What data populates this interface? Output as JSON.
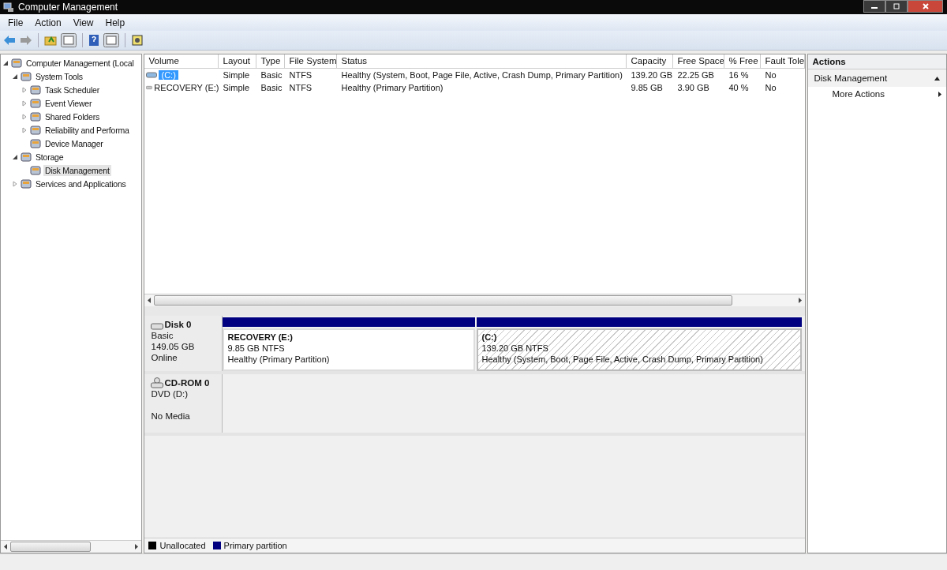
{
  "window": {
    "title": "Computer Management"
  },
  "menu": [
    "File",
    "Action",
    "View",
    "Help"
  ],
  "tree": [
    {
      "label": "Computer Management (Local",
      "expanded": true,
      "selected": false,
      "children": [
        {
          "label": "System Tools",
          "expanded": true,
          "selected": false,
          "children": [
            {
              "label": "Task Scheduler",
              "expanded": false,
              "selected": false
            },
            {
              "label": "Event Viewer",
              "expanded": false,
              "selected": false
            },
            {
              "label": "Shared Folders",
              "expanded": false,
              "selected": false
            },
            {
              "label": "Reliability and Performa",
              "expanded": false,
              "selected": false
            },
            {
              "label": "Device Manager",
              "selected": false
            }
          ]
        },
        {
          "label": "Storage",
          "expanded": true,
          "selected": false,
          "children": [
            {
              "label": "Disk Management",
              "selected": true
            }
          ]
        },
        {
          "label": "Services and Applications",
          "expanded": false,
          "selected": false
        }
      ]
    }
  ],
  "volumes": {
    "columns": [
      "Volume",
      "Layout",
      "Type",
      "File System",
      "Status",
      "Capacity",
      "Free Space",
      "% Free",
      "Fault Tole"
    ],
    "rows": [
      {
        "selected": true,
        "cells": [
          "(C:)",
          "Simple",
          "Basic",
          "NTFS",
          "Healthy (System, Boot, Page File, Active, Crash Dump, Primary Partition)",
          "139.20 GB",
          "22.25 GB",
          "16 %",
          "No"
        ]
      },
      {
        "selected": false,
        "cells": [
          "RECOVERY (E:)",
          "Simple",
          "Basic",
          "NTFS",
          "Healthy (Primary Partition)",
          "9.85 GB",
          "3.90 GB",
          "40 %",
          "No"
        ]
      }
    ]
  },
  "disks": [
    {
      "name": "Disk 0",
      "kind": "disk",
      "lines": [
        "Basic",
        "149.05 GB",
        "Online"
      ],
      "partitions": [
        {
          "name": "RECOVERY  (E:)",
          "size": "9.85 GB NTFS",
          "status": "Healthy (Primary Partition)",
          "selected": false
        },
        {
          "name": "(C:)",
          "size": "139.20 GB NTFS",
          "status": "Healthy (System, Boot, Page File, Active, Crash Dump, Primary Partition)",
          "selected": true
        }
      ]
    },
    {
      "name": "CD-ROM 0",
      "kind": "cdrom",
      "lines": [
        "DVD (D:)",
        "No Media"
      ]
    }
  ],
  "legend": [
    {
      "label": "Unallocated",
      "color": "#000000"
    },
    {
      "label": "Primary partition",
      "color": "#000080"
    }
  ],
  "actions": {
    "title": "Actions",
    "sections": [
      {
        "label": "Disk Management",
        "expanded": true,
        "items": [
          "More Actions"
        ]
      }
    ]
  }
}
